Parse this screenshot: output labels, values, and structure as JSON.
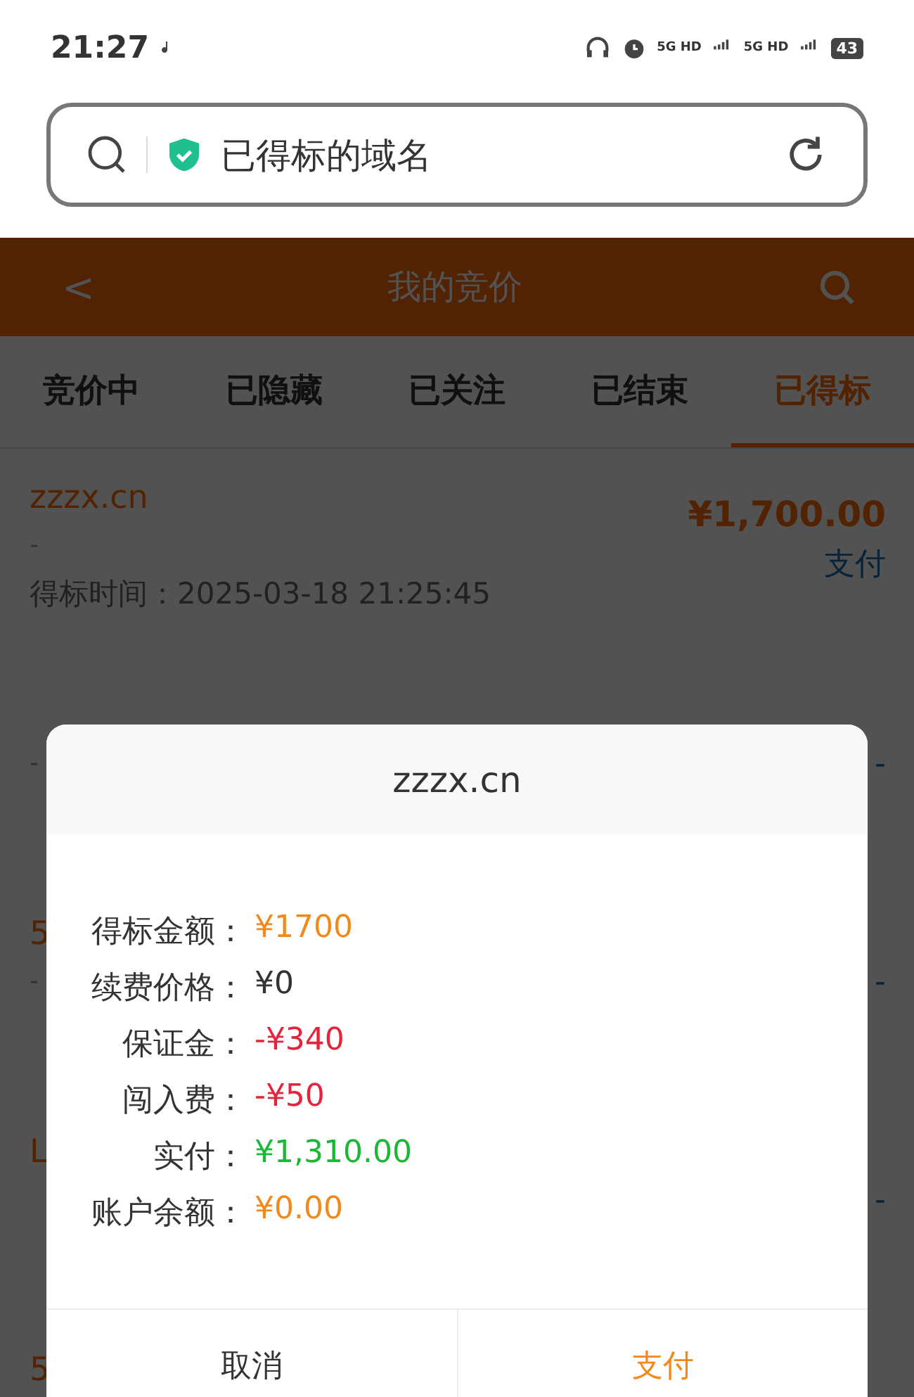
{
  "status_bar": {
    "time": "21:27",
    "battery": "43",
    "network_1": "5G HD",
    "network_2": "5G HD"
  },
  "address_bar": {
    "title": "已得标的域名"
  },
  "header": {
    "back": "<",
    "title": "我的竞价"
  },
  "tabs": [
    {
      "label": "竞价中",
      "selected": false
    },
    {
      "label": "已隐藏",
      "selected": false
    },
    {
      "label": "已关注",
      "selected": false
    },
    {
      "label": "已结束",
      "selected": false
    },
    {
      "label": "已得标",
      "selected": true
    }
  ],
  "list": [
    {
      "name": "zzzx.cn",
      "remark": "-",
      "time": "得标时间：2025-03-18 21:25:45",
      "price": "¥1,700.00",
      "action": "支付"
    },
    {
      "remark": "-",
      "action": "-"
    },
    {
      "name": "5",
      "remark": "-",
      "action": "-"
    },
    {
      "name": "L",
      "action": "-"
    },
    {
      "name": "5"
    }
  ],
  "dialog": {
    "title": "zzzx.cn",
    "rows": [
      {
        "label": "得标金额：",
        "value": "¥1700",
        "color": "#f08a1c"
      },
      {
        "label": "续费价格：",
        "value": "¥0",
        "color": "#333333"
      },
      {
        "label": "保证金：",
        "value": "-¥340",
        "color": "#e5243b"
      },
      {
        "label": "闯入费：",
        "value": "-¥50",
        "color": "#e5243b"
      },
      {
        "label": "实付：",
        "value": "¥1,310.00",
        "color": "#1ab836"
      },
      {
        "label": "账户余额：",
        "value": "¥0.00",
        "color": "#f08a1c"
      }
    ],
    "buttons": [
      {
        "label": "取消",
        "kind": "cancel"
      },
      {
        "label": "支付",
        "kind": "confirm"
      }
    ]
  }
}
